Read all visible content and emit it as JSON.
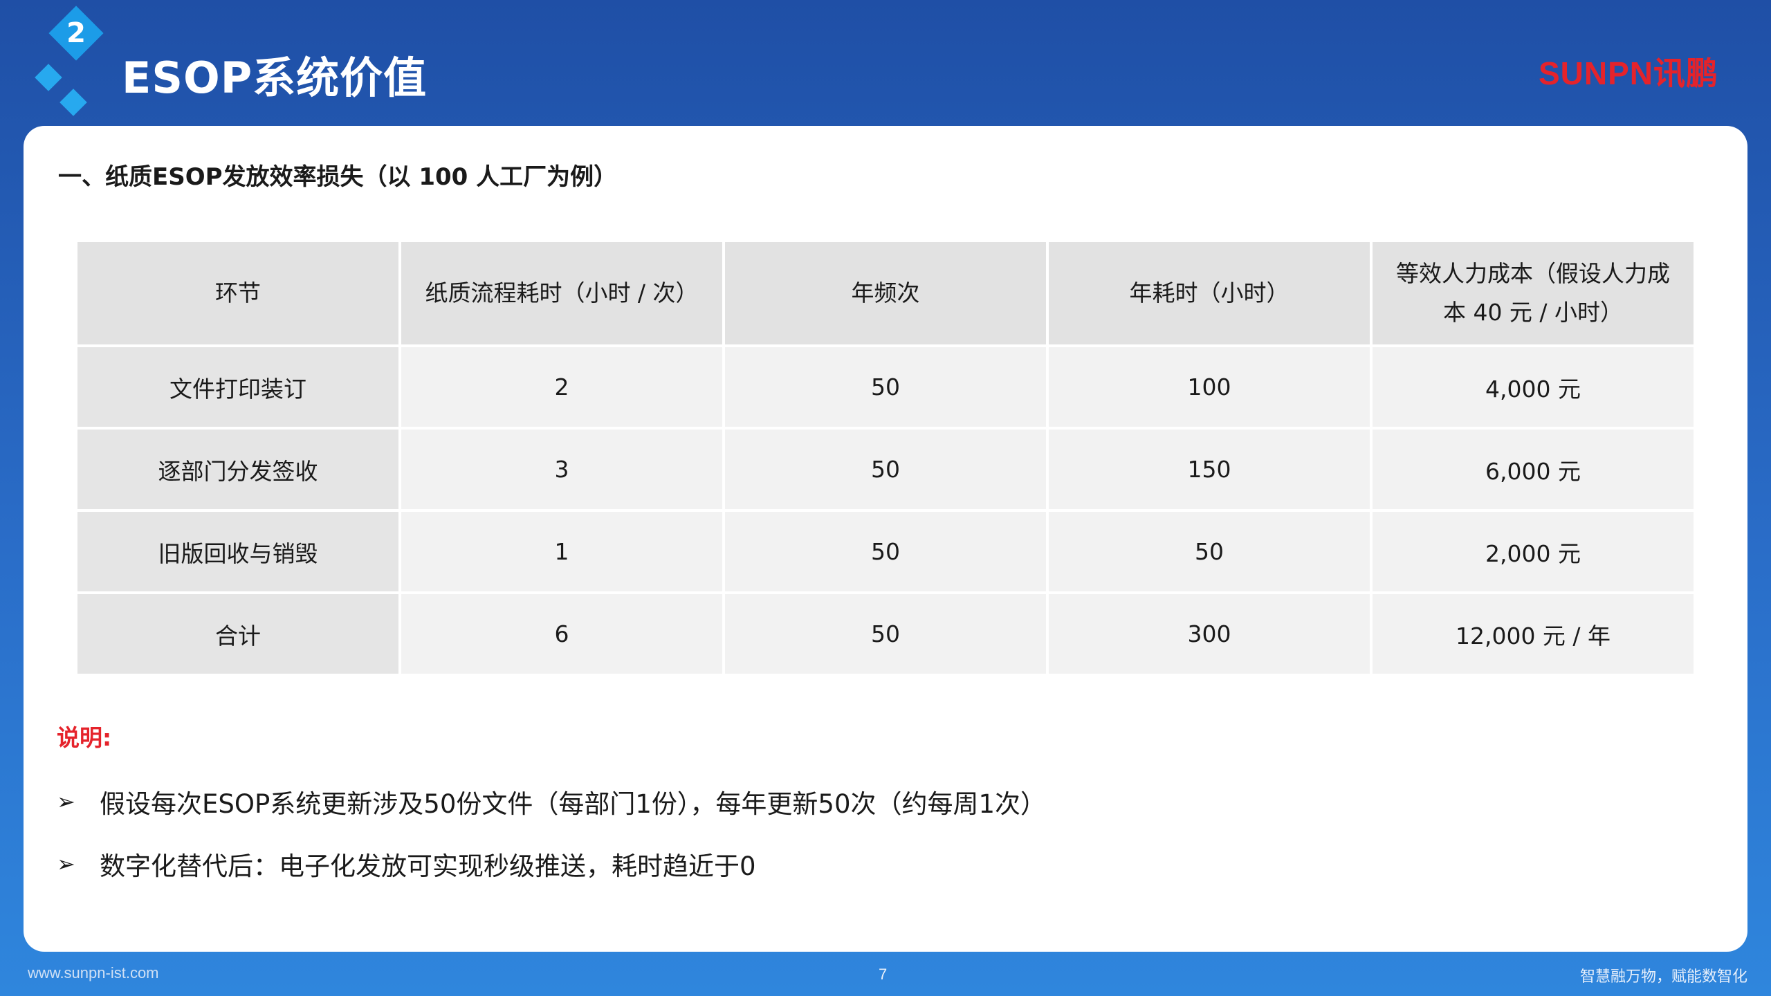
{
  "header": {
    "section_number": "2",
    "title": "ESOP系统价值",
    "brand": "SUNPN讯鹏"
  },
  "section": {
    "heading": "一、纸质ESOP发放效率损失（以 100 人工厂为例）"
  },
  "table": {
    "headers": [
      "环节",
      "纸质流程耗时（小时 / 次）",
      "年频次",
      "年耗时（小时）",
      "等效人力成本（假设人力成本 40 元 / 小时）"
    ],
    "rows": [
      [
        "文件打印装订",
        "2",
        "50",
        "100",
        "4,000 元"
      ],
      [
        "逐部门分发签收",
        "3",
        "50",
        "150",
        "6,000 元"
      ],
      [
        "旧版回收与销毁",
        "1",
        "50",
        "50",
        "2,000 元"
      ],
      [
        "合计",
        "6",
        "50",
        "300",
        "12,000 元 / 年"
      ]
    ]
  },
  "notes": {
    "label": "说明:",
    "bullet_icon": "arrow-bullet-icon",
    "items": [
      "假设每次ESOP系统更新涉及50份文件（每部门1份），每年更新50次（约每周1次）",
      "数字化替代后：电子化发放可实现秒级推送，耗时趋近于0"
    ]
  },
  "footer": {
    "url": "www.sunpn-ist.com",
    "page_number": "7",
    "slogan": "智慧融万物，赋能数智化"
  },
  "colors": {
    "accent_red": "#e5232b",
    "header_blue": "#1f4fa6",
    "diamond_blue": "#1c9ce8"
  }
}
